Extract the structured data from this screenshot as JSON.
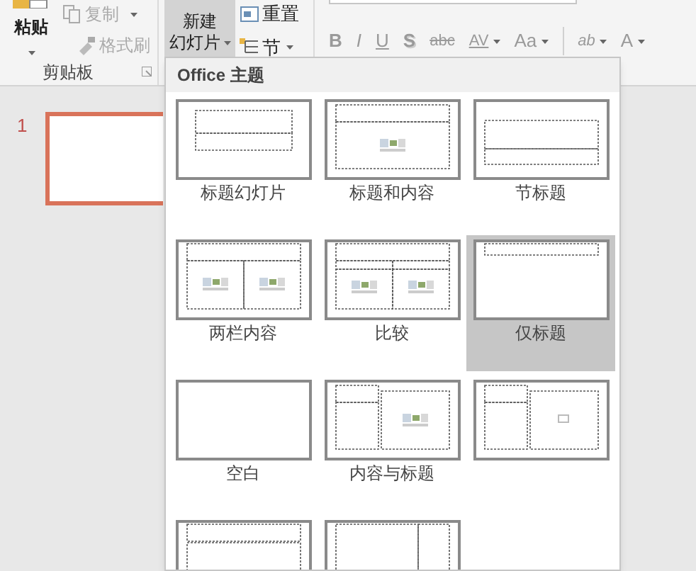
{
  "ribbon": {
    "paste": "粘贴",
    "copy": {
      "label": "复制",
      "disabled": true
    },
    "format_painter": {
      "label": "格式刷",
      "disabled": true
    },
    "clipboard_label": "剪贴板",
    "new_slide": {
      "line1": "新建",
      "line2": "幻灯片",
      "selected": true
    },
    "reset": "重置",
    "section": "节",
    "font_group": {
      "disabled": true,
      "buttons": [
        {
          "text": "B",
          "kind": "bold",
          "caret": false
        },
        {
          "text": "I",
          "kind": "italic",
          "caret": false
        },
        {
          "text": "U",
          "kind": "underline",
          "caret": false
        },
        {
          "text": "S",
          "kind": "shadow",
          "caret": false
        },
        {
          "text": "abc",
          "kind": "strike",
          "caret": false
        },
        {
          "text": "AV",
          "kind": "spacing",
          "caret": true
        },
        {
          "text": "Aa",
          "kind": "plain",
          "caret": true
        },
        {
          "text": "ab",
          "kind": "highlight",
          "caret": true
        },
        {
          "text": "A",
          "kind": "plain",
          "caret": true
        }
      ]
    }
  },
  "slides": [
    {
      "number": "1",
      "selected": true
    }
  ],
  "layout_gallery": {
    "header": "Office 主题",
    "layouts": [
      {
        "kind": "title",
        "label": "标题幻灯片",
        "selected": false
      },
      {
        "kind": "title_content",
        "label": "标题和内容",
        "selected": false
      },
      {
        "kind": "section",
        "label": "节标题",
        "selected": false
      },
      {
        "kind": "two_content",
        "label": "两栏内容",
        "selected": false
      },
      {
        "kind": "comparison",
        "label": "比较",
        "selected": false
      },
      {
        "kind": "title_only",
        "label": "仅标题",
        "selected": true
      },
      {
        "kind": "blank",
        "label": "空白",
        "selected": false
      },
      {
        "kind": "content_caption",
        "label": "内容与标题",
        "selected": false
      },
      {
        "kind": "picture_caption",
        "selected": false
      },
      {
        "kind": "title_vertical_text",
        "selected": false
      },
      {
        "kind": "vertical_title_text",
        "selected": false
      }
    ]
  }
}
